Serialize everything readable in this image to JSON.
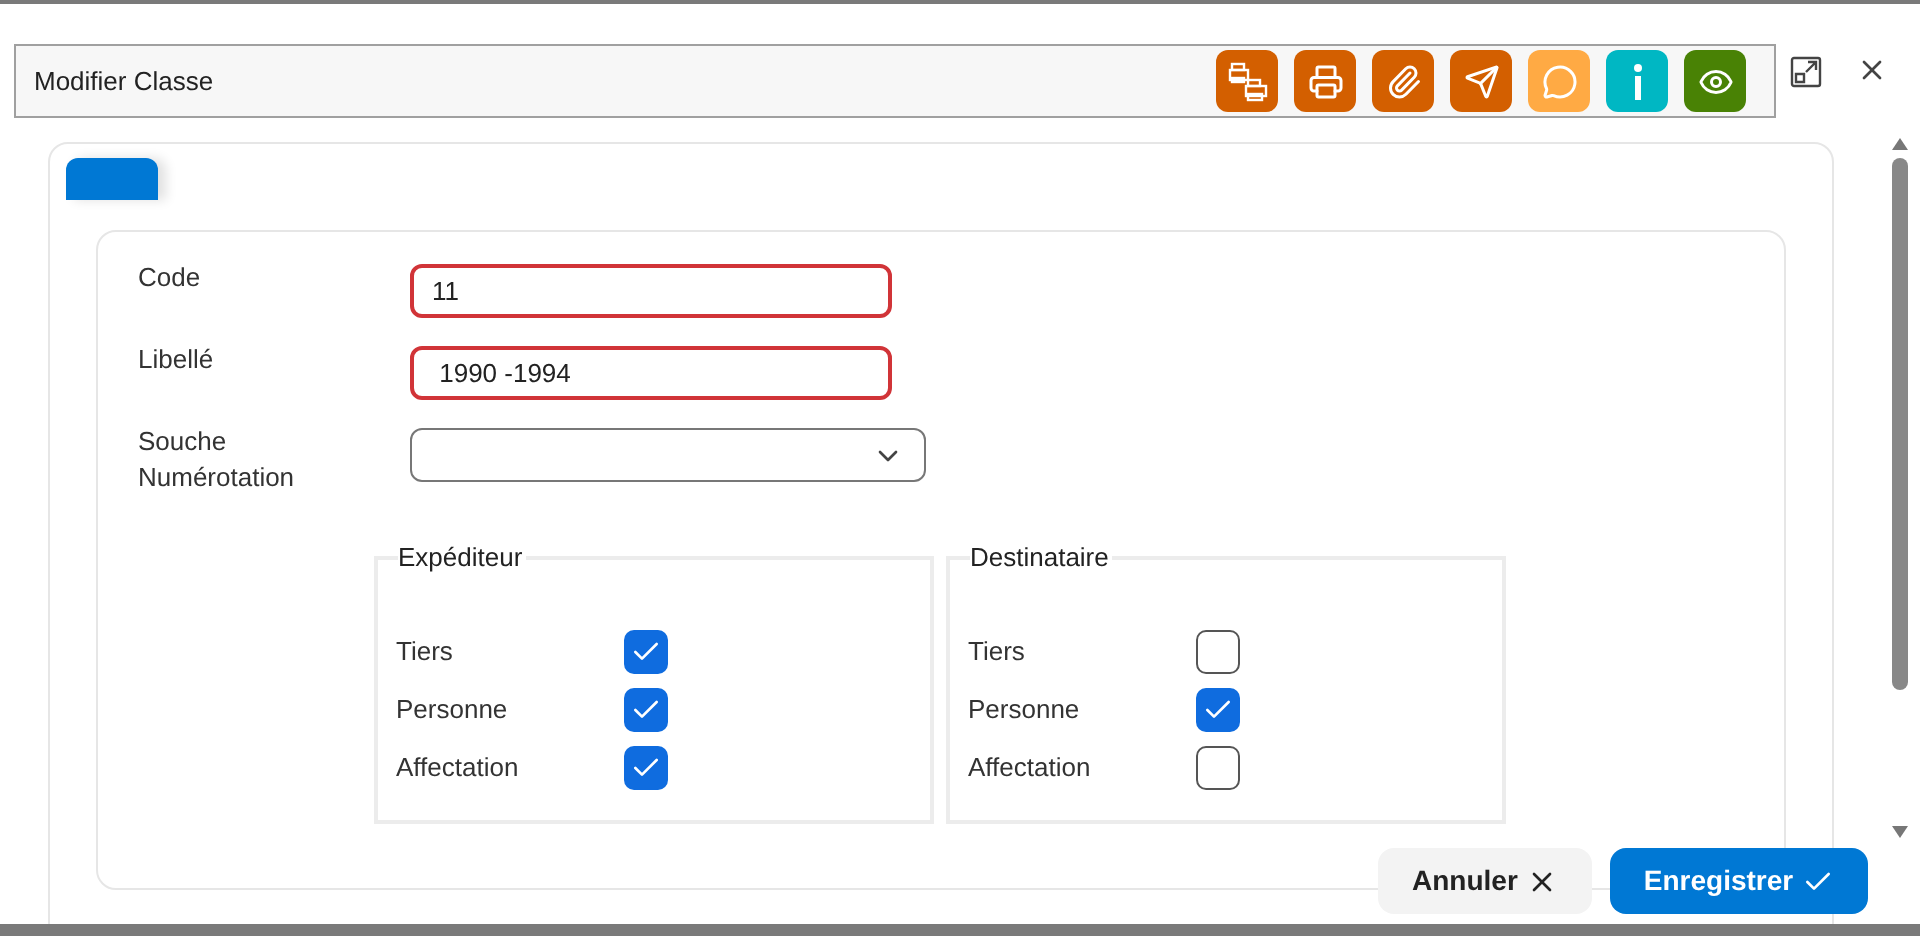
{
  "header": {
    "title": "Modifier Classe"
  },
  "toolbar": [
    {
      "kind": "multi-print",
      "color": "#d35f00"
    },
    {
      "kind": "print",
      "color": "#d35f00"
    },
    {
      "kind": "attach",
      "color": "#d35f00"
    },
    {
      "kind": "send",
      "color": "#d35f00"
    },
    {
      "kind": "comment",
      "color": "#ffaa44"
    },
    {
      "kind": "info",
      "color": "#00b7c3"
    },
    {
      "kind": "view",
      "color": "#498205"
    }
  ],
  "tabs": [
    {
      "selected": true
    }
  ],
  "fields": [
    {
      "kind": "text",
      "label": "Code",
      "value": "11",
      "invalid": true
    },
    {
      "kind": "text",
      "label": "Libellé",
      "value": " 1990 -1994",
      "invalid": true
    },
    {
      "kind": "select",
      "label": "Souche Numérotation",
      "invalid": false
    }
  ],
  "groups": [
    {
      "title": "Expéditeur",
      "items": [
        {
          "label": "Tiers",
          "checked": true
        },
        {
          "label": "Personne",
          "checked": true
        },
        {
          "label": "Affectation",
          "checked": true
        }
      ]
    },
    {
      "title": "Destinataire",
      "items": [
        {
          "label": "Tiers",
          "checked": false
        },
        {
          "label": "Personne",
          "checked": true
        },
        {
          "label": "Affectation",
          "checked": false
        }
      ]
    }
  ],
  "buttons": [
    {
      "kind": "cancel",
      "label": "Annuler"
    },
    {
      "kind": "save",
      "label": "Enregistrer"
    }
  ]
}
